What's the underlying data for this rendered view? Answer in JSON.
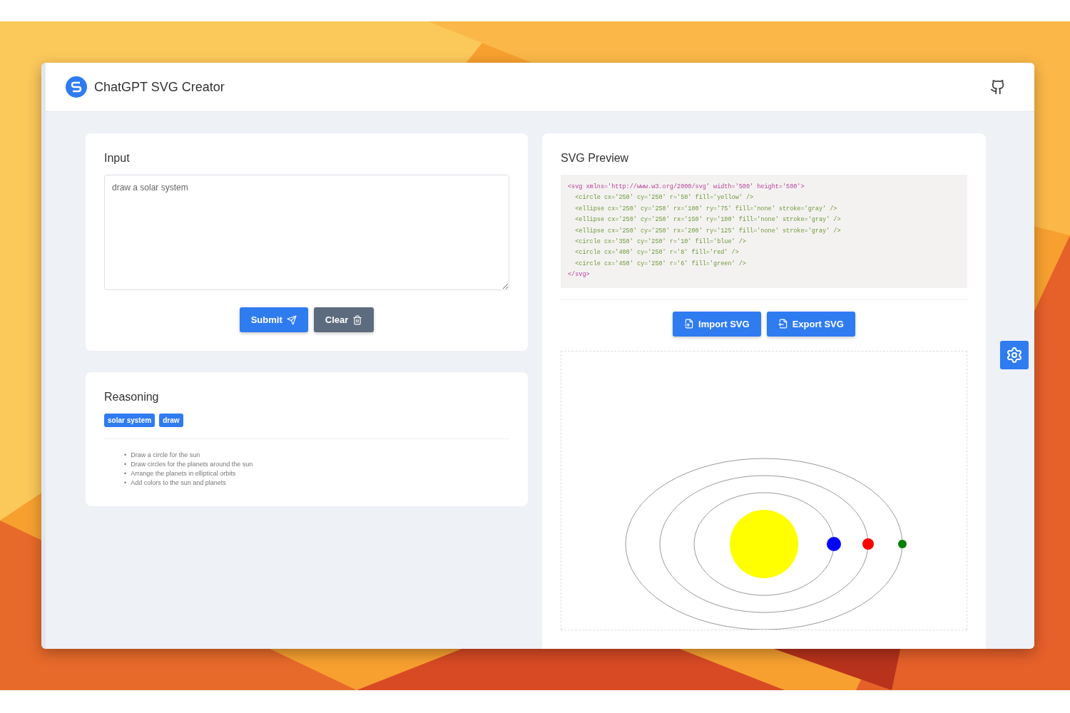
{
  "header": {
    "title": "ChatGPT SVG Creator"
  },
  "input_card": {
    "title": "Input",
    "prompt": {
      "value": "draw a solar system"
    },
    "buttons": [
      {
        "label": "Submit",
        "kind": "submit"
      },
      {
        "label": "Clear",
        "kind": "clear"
      }
    ]
  },
  "reasoning_card": {
    "title": "Reasoning",
    "tags": [
      "solar system",
      "draw"
    ],
    "steps": [
      {
        "marker": "•",
        "text": "Draw a circle for the sun"
      },
      {
        "marker": "•",
        "text": "Draw circles for the planets around the sun"
      },
      {
        "marker": "•",
        "text": "Arrange the planets in elliptical orbits"
      },
      {
        "marker": "•",
        "text": "Add colors to the sun and planets"
      }
    ]
  },
  "preview_card": {
    "title": "SVG Preview",
    "code_lines": [
      "<svg xmlns='http://www.w3.org/2000/svg' width='500' height='500'>",
      "  <circle cx='250' cy='250' r='50' fill='yellow' />",
      "  <ellipse cx='250' cy='250' rx='100' ry='75' fill='none' stroke='gray' />",
      "  <ellipse cx='250' cy='250' rx='150' ry='100' fill='none' stroke='gray' />",
      "  <ellipse cx='250' cy='250' rx='200' ry='125' fill='none' stroke='gray' />",
      "  <circle cx='350' cy='250' r='10' fill='blue' />",
      "  <circle cx='400' cy='250' r='8' fill='red' />",
      "  <circle cx='450' cy='250' r='6' fill='green' />",
      "</svg>"
    ],
    "buttons": [
      {
        "label": "Import SVG",
        "kind": "import"
      },
      {
        "label": "Export SVG",
        "kind": "export"
      }
    ]
  }
}
